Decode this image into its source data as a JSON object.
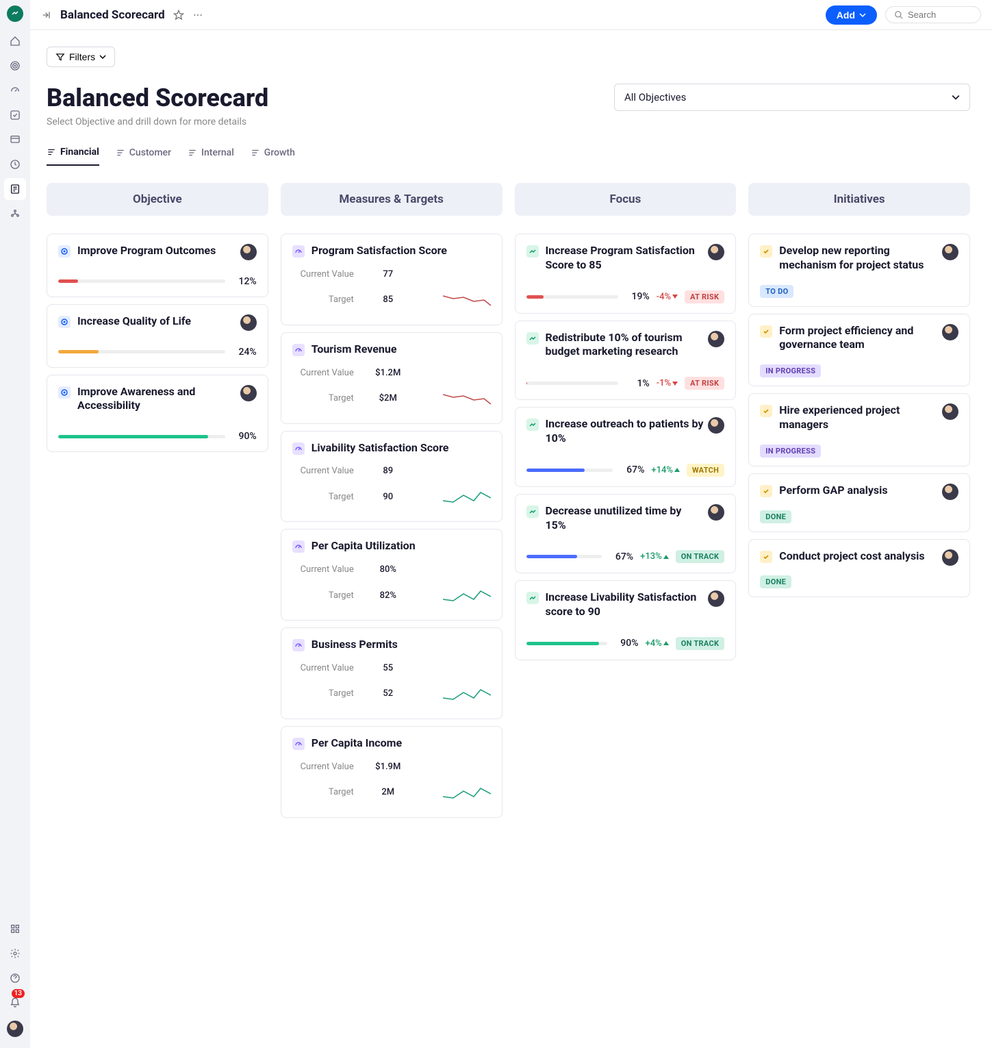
{
  "topbar": {
    "title": "Balanced Scorecard",
    "add_label": "Add",
    "search_placeholder": "Search"
  },
  "filters_label": "Filters",
  "page": {
    "title": "Balanced Scorecard",
    "subtitle": "Select Objective and drill down for more details",
    "dropdown_label": "All Objectives"
  },
  "tabs": {
    "financial": "Financial",
    "customer": "Customer",
    "internal": "Internal",
    "growth": "Growth"
  },
  "columns": {
    "objective": "Objective",
    "measures": "Measures & Targets",
    "focus": "Focus",
    "initiatives": "Initiatives"
  },
  "objectives": [
    {
      "title": "Improve Program Outcomes",
      "pct": "12%",
      "fill": 12,
      "color": "#e05050"
    },
    {
      "title": "Increase Quality of Life",
      "pct": "24%",
      "fill": 24,
      "color": "#f2a93b"
    },
    {
      "title": "Improve Awareness and Accessibility",
      "pct": "90%",
      "fill": 90,
      "color": "#1ec28b"
    }
  ],
  "measures": [
    {
      "title": "Program Satisfaction Score",
      "cv": "77",
      "tg": "85",
      "spark": "down"
    },
    {
      "title": "Tourism Revenue",
      "cv": "$1.2M",
      "tg": "$2M",
      "spark": "down"
    },
    {
      "title": "Livability Satisfaction Score",
      "cv": "89",
      "tg": "90",
      "spark": "up"
    },
    {
      "title": "Per Capita Utilization",
      "cv": "80%",
      "tg": "82%",
      "spark": "up"
    },
    {
      "title": "Business Permits",
      "cv": "55",
      "tg": "52",
      "spark": "up"
    },
    {
      "title": "Per Capita Income",
      "cv": "$1.9M",
      "tg": "2M",
      "spark": "up"
    }
  ],
  "labels": {
    "current_value": "Current Value",
    "target": "Target"
  },
  "focus": [
    {
      "title": "Increase Program Satisfaction Score to 85",
      "pct": "19%",
      "fill": 19,
      "color": "#e05050",
      "delta": "-4%",
      "dir": "down",
      "status": "AT RISK",
      "stclass": "st-risk"
    },
    {
      "title": "Redistribute 10% of tourism budget marketing research",
      "pct": "1%",
      "fill": 1,
      "color": "#e05050",
      "delta": "-1%",
      "dir": "down",
      "status": "AT RISK",
      "stclass": "st-risk"
    },
    {
      "title": "Increase outreach to patients by 10%",
      "pct": "67%",
      "fill": 67,
      "color": "#4b6bff",
      "delta": "+14%",
      "dir": "up",
      "status": "WATCH",
      "stclass": "st-watch"
    },
    {
      "title": "Decrease unutilized time by 15%",
      "pct": "67%",
      "fill": 67,
      "color": "#4b6bff",
      "delta": "+13%",
      "dir": "up",
      "status": "ON TRACK",
      "stclass": "st-track"
    },
    {
      "title": "Increase Livability Satisfaction score to 90",
      "pct": "90%",
      "fill": 90,
      "color": "#1ec28b",
      "delta": "+4%",
      "dir": "up",
      "status": "ON TRACK",
      "stclass": "st-track"
    }
  ],
  "initiatives": [
    {
      "title": "Develop new reporting mechanism for project status",
      "status": "TO DO",
      "stclass": "st-todo"
    },
    {
      "title": "Form project efficiency and governance team",
      "status": "IN PROGRESS",
      "stclass": "st-prog"
    },
    {
      "title": "Hire experienced project managers",
      "status": "IN PROGRESS",
      "stclass": "st-prog"
    },
    {
      "title": "Perform GAP analysis",
      "status": "DONE",
      "stclass": "st-done"
    },
    {
      "title": "Conduct project cost analysis",
      "status": "DONE",
      "stclass": "st-done"
    }
  ],
  "notif_count": "13"
}
